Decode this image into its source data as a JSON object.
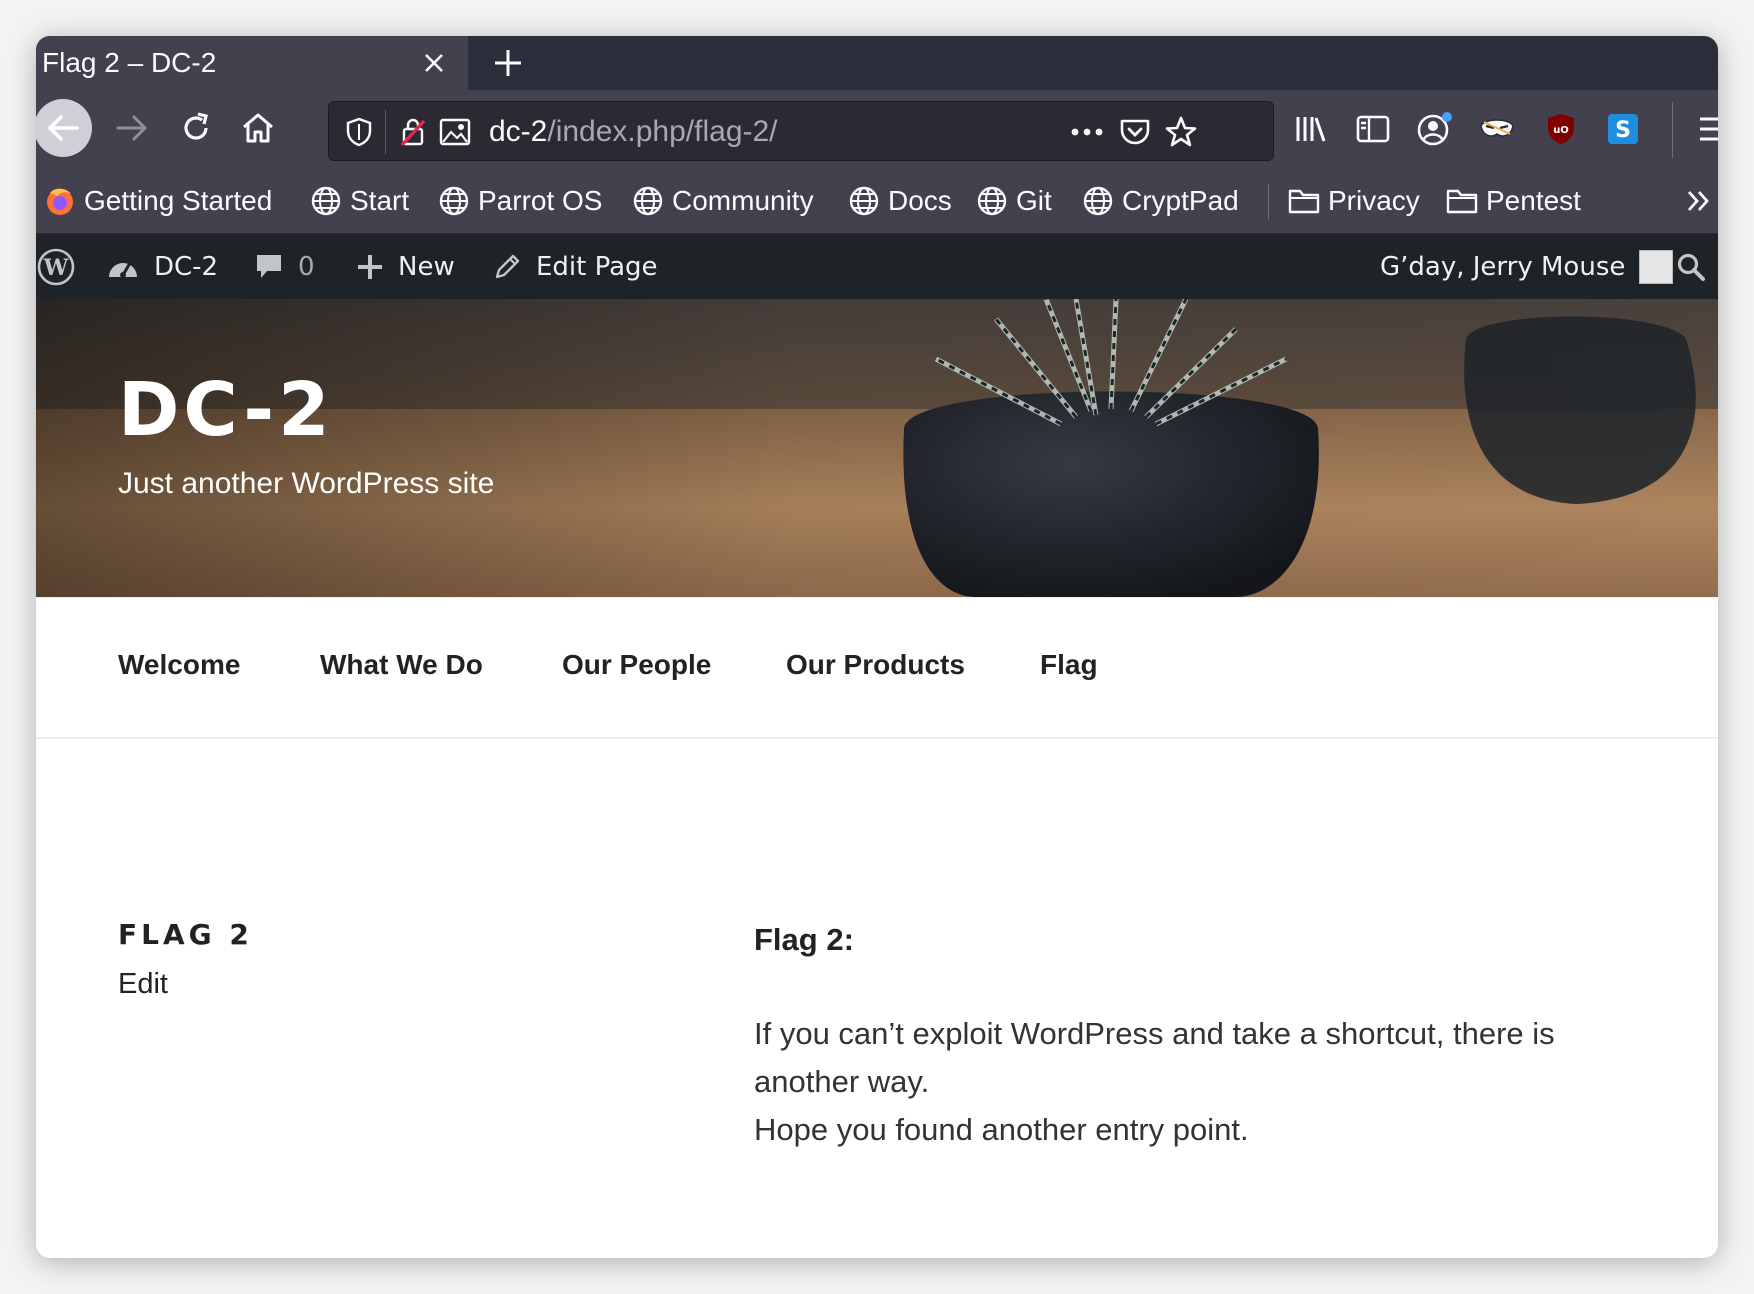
{
  "browser": {
    "tab_title": "Flag 2 – DC-2",
    "url_host": "dc-2",
    "url_path": "/index.php/flag-2/",
    "bookmarks": [
      {
        "label": "Getting Started",
        "icon": "firefox-icon"
      },
      {
        "label": "Start",
        "icon": "globe-icon"
      },
      {
        "label": "Parrot OS",
        "icon": "globe-icon"
      },
      {
        "label": "Community",
        "icon": "globe-icon"
      },
      {
        "label": "Docs",
        "icon": "globe-icon"
      },
      {
        "label": "Git",
        "icon": "globe-icon"
      },
      {
        "label": "CryptPad",
        "icon": "globe-icon"
      },
      {
        "label": "Privacy",
        "icon": "folder-icon"
      },
      {
        "label": "Pentest",
        "icon": "folder-icon"
      }
    ]
  },
  "adminbar": {
    "site_name": "DC-2",
    "comment_count": "0",
    "new_label": "New",
    "edit_label": "Edit Page",
    "greeting": "G’day, Jerry Mouse"
  },
  "site": {
    "title": "DC-2",
    "description": "Just another WordPress site"
  },
  "menu": [
    "Welcome",
    "What We Do",
    "Our People",
    "Our Products",
    "Flag"
  ],
  "page": {
    "title": "FLAG 2",
    "edit_link": "Edit",
    "heading": "Flag 2:",
    "paragraph1": "If you can’t exploit WordPress and take a shortcut, there is another way.",
    "paragraph2": "Hope you found another entry point."
  },
  "colors": {
    "toolbar": "#42414d",
    "tabstrip": "#2b2e3b",
    "adminbar": "#1d2327"
  }
}
